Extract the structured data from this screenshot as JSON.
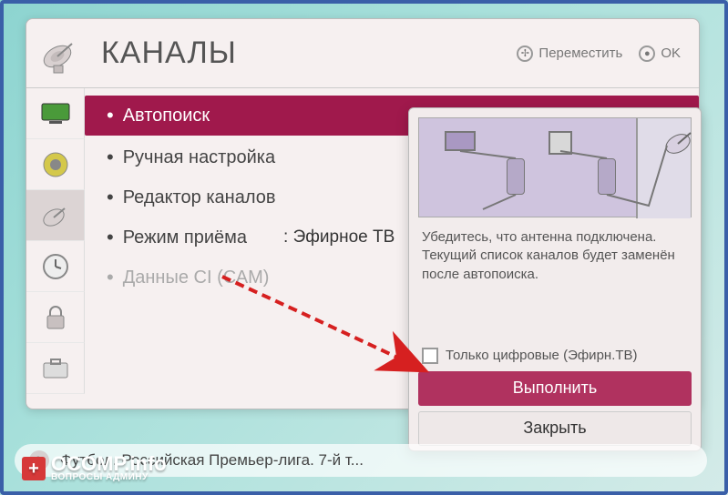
{
  "title": "КАНАЛЫ",
  "hints": {
    "move": "Переместить",
    "ok": "OK"
  },
  "sidebar_icons": [
    "tv",
    "speaker",
    "antenna",
    "clock",
    "lock",
    "briefcase"
  ],
  "menu": {
    "items": [
      {
        "label": "Автопоиск",
        "selected": true
      },
      {
        "label": "Ручная настройка"
      },
      {
        "label": "Редактор каналов"
      },
      {
        "label": "Режим приёма",
        "value": ": Эфирное ТВ"
      },
      {
        "label": "Данные CI (САМ)",
        "disabled": true
      }
    ]
  },
  "popup": {
    "text1": "Убедитесь, что антенна подключена.",
    "text2": "Текущий список каналов будет заменён после автопоиска.",
    "checkbox_label": "Только цифровые (Эфирн.ТВ)",
    "primary": "Выполнить",
    "secondary": "Закрыть"
  },
  "footer": "Футбол. Российская Премьер-лига. 7-й т...",
  "watermark": {
    "name": "OCOMP.info",
    "sub": "ВОПРОСЫ АДМИНУ"
  }
}
